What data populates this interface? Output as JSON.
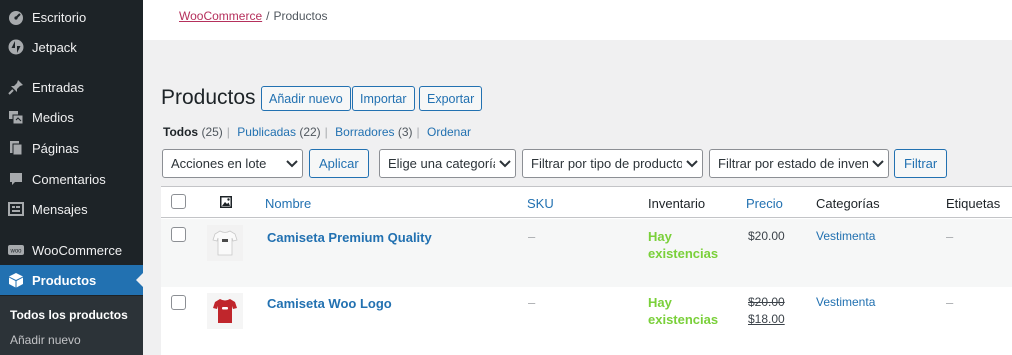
{
  "sidebar": {
    "items": [
      {
        "label": "Escritorio",
        "icon": "dashboard-icon"
      },
      {
        "label": "Jetpack",
        "icon": "jetpack-icon"
      },
      {
        "label": "Entradas",
        "icon": "pin-icon"
      },
      {
        "label": "Medios",
        "icon": "media-icon"
      },
      {
        "label": "Páginas",
        "icon": "pages-icon"
      },
      {
        "label": "Comentarios",
        "icon": "comment-icon"
      },
      {
        "label": "Mensajes",
        "icon": "messages-icon"
      },
      {
        "label": "WooCommerce",
        "icon": "woocommerce-icon"
      },
      {
        "label": "Productos",
        "icon": "box-icon"
      }
    ],
    "submenu": {
      "current": "Todos los productos",
      "add": "Añadir nuevo"
    }
  },
  "breadcrumb": {
    "link": "WooCommerce",
    "separator": "/",
    "current": "Productos"
  },
  "page": {
    "title": "Productos",
    "add_new": "Añadir nuevo",
    "import": "Importar",
    "export": "Exportar"
  },
  "views": {
    "all": "Todos",
    "all_count": "(25)",
    "published": "Publicadas",
    "published_count": "(22)",
    "drafts": "Borradores",
    "drafts_count": "(3)",
    "sort": "Ordenar"
  },
  "filters": {
    "bulk_actions": "Acciones en lote",
    "apply": "Aplicar",
    "category": "Elige una categoría",
    "product_type": "Filtrar por tipo de producto",
    "stock_status": "Filtrar por estado de inventario",
    "filter": "Filtrar"
  },
  "table": {
    "columns": {
      "name": "Nombre",
      "sku": "SKU",
      "stock": "Inventario",
      "price": "Precio",
      "categories": "Categorías",
      "tags": "Etiquetas"
    },
    "rows": [
      {
        "name": "Camiseta Premium Quality",
        "sku": "–",
        "stock_line1": "Hay",
        "stock_line2": "existencias",
        "price": "$20.00",
        "category": "Vestimenta",
        "tags": "–",
        "thumb_color": "#f2f2f2"
      },
      {
        "name": "Camiseta Woo Logo",
        "sku": "–",
        "stock_line1": "Hay",
        "stock_line2": "existencias",
        "price_old": "$20.00",
        "price_new": "$18.00",
        "category": "Vestimenta",
        "tags": "–",
        "thumb_color": "#c0262c"
      }
    ]
  },
  "colors": {
    "sidebar_bg": "#1d2327",
    "accent": "#2271b1",
    "in_stock": "#7ad03a",
    "woocommerce_link": "#b5305c"
  }
}
